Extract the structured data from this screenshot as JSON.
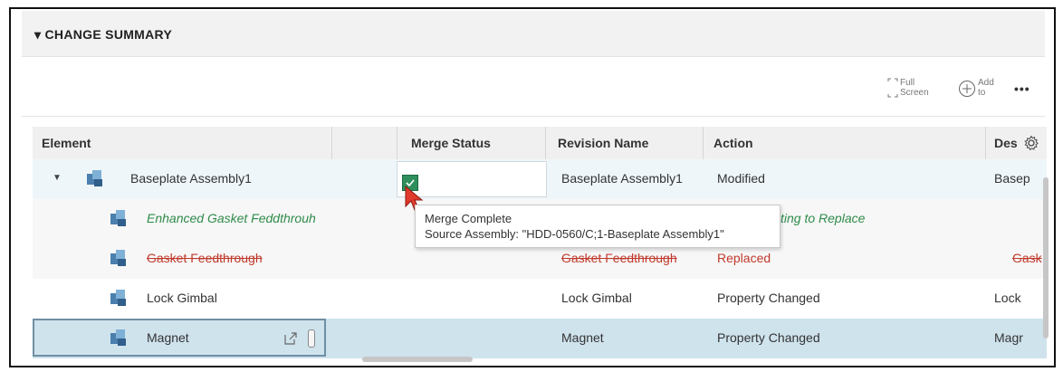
{
  "section": {
    "title": "▾ CHANGE SUMMARY"
  },
  "toolbar": {
    "full_screen_top": "Full",
    "full_screen_bottom": "Screen",
    "add_top": "Add",
    "add_bottom": "to",
    "more": "•••"
  },
  "columns": {
    "element": "Element",
    "merge_status": "Merge Status",
    "revision_name": "Revision Name",
    "action": "Action",
    "description": "Des"
  },
  "rows": [
    {
      "element": "Baseplate Assembly1",
      "revision": "Baseplate Assembly1",
      "action": "Modified",
      "desc": "Basep"
    },
    {
      "element": "Enhanced Gasket Feddthrouh",
      "revision": "",
      "action": "ting to Replace",
      "desc": ""
    },
    {
      "element": "Gasket Feedthrough",
      "revision": "Gasket Feedthrough",
      "action": "Replaced",
      "desc": "Gask"
    },
    {
      "element": "Lock Gimbal",
      "revision": "Lock Gimbal",
      "action": "Property Changed",
      "desc": "Lock"
    },
    {
      "element": "Magnet",
      "revision": "Magnet",
      "action": "Property Changed",
      "desc": "Magr"
    }
  ],
  "tooltip": {
    "line1": "Merge Complete",
    "line2": "Source Assembly: \"HDD-0560/C;1-Baseplate Assembly1\""
  },
  "colors": {
    "green_text": "#2e8b4a",
    "red_text": "#c0392b",
    "selected_row": "#cfe3ed",
    "merge_box": "#2f8f5c"
  }
}
